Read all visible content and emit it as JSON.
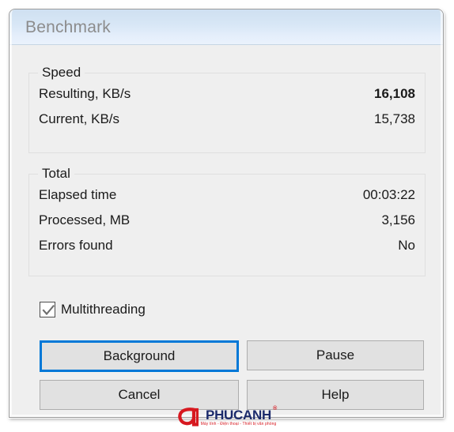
{
  "window": {
    "title": "Benchmark"
  },
  "groups": [
    {
      "id": "speed",
      "title": "Speed",
      "rows": [
        {
          "label": "Resulting, KB/s",
          "value": "16,108",
          "bold": true
        },
        {
          "label": "Current, KB/s",
          "value": "15,738",
          "bold": false
        }
      ]
    },
    {
      "id": "total",
      "title": "Total",
      "rows": [
        {
          "label": "Elapsed time",
          "value": "00:03:22",
          "bold": false
        },
        {
          "label": "Processed, MB",
          "value": "3,156",
          "bold": false
        },
        {
          "label": "Errors found",
          "value": "No",
          "bold": false
        }
      ]
    }
  ],
  "options": {
    "multithreading": {
      "label": "Multithreading",
      "checked": true,
      "icon": "checkmark-icon"
    }
  },
  "buttons": {
    "background": "Background",
    "pause": "Pause",
    "cancel": "Cancel",
    "help": "Help"
  },
  "focus": {
    "focused_button": "Background",
    "focus_color": "#0078d7"
  },
  "watermark": {
    "mark_icon": "phucanh-a-logo-icon",
    "wordmark": "PHUCANH",
    "superscript": "®",
    "tagline": "Máy tính - Điện thoại - Thiết bị văn phòng",
    "brand_color": "#d71920",
    "wordmark_color": "#1b2a6b"
  },
  "theme": {
    "titlebar_top": "#cfe0f1",
    "titlebar_bottom": "#eaf2fc",
    "body_bg": "#efefef",
    "button_bg": "#e1e1e1",
    "button_border": "#adadad",
    "group_border": "#dfdfdf",
    "text_color": "#1a1a1a",
    "title_text_color": "#8c8c8c"
  }
}
